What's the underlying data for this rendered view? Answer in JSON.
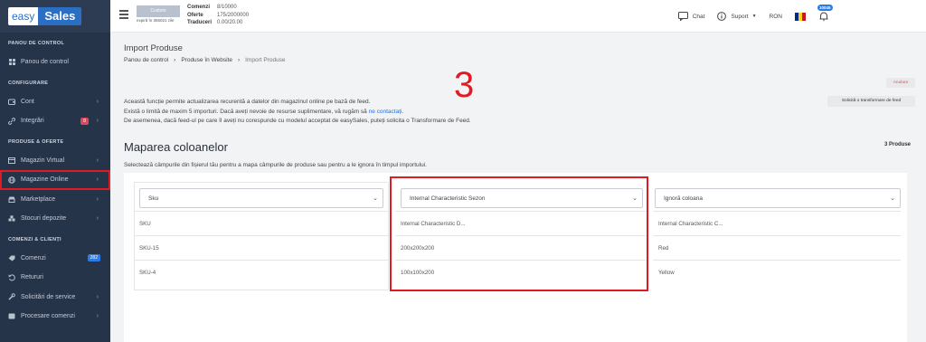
{
  "brand": {
    "easy": "easy",
    "sales": "Sales"
  },
  "sidebar": {
    "sections": [
      {
        "title": "PANOU DE CONTROL",
        "items": [
          {
            "label": "Panou de control",
            "icon": "dashboard-icon"
          }
        ]
      },
      {
        "title": "CONFIGURARE",
        "items": [
          {
            "label": "Cont",
            "icon": "wallet-icon",
            "chevron": true
          },
          {
            "label": "Integrări",
            "icon": "link-icon",
            "chevron": true,
            "badge": "8",
            "badge_color": "#e0455a"
          }
        ]
      },
      {
        "title": "PRODUSE & OFERTE",
        "items": [
          {
            "label": "Magazin Virtual",
            "icon": "store-icon",
            "chevron": true
          },
          {
            "label": "Magazine Online",
            "icon": "globe-icon",
            "chevron": true,
            "highlighted": true
          },
          {
            "label": "Marketplace",
            "icon": "marketplace-icon",
            "chevron": true
          },
          {
            "label": "Stocuri depozite",
            "icon": "warehouse-icon",
            "chevron": true
          }
        ]
      },
      {
        "title": "COMENZI & CLIENȚI",
        "items": [
          {
            "label": "Comenzi",
            "icon": "orders-icon",
            "badge": "282",
            "badge_color": "#2d7be5"
          },
          {
            "label": "Retururi",
            "icon": "returns-icon"
          },
          {
            "label": "Solicitări de service",
            "icon": "wrench-icon",
            "chevron": true
          },
          {
            "label": "Procesare comenzi",
            "icon": "process-icon",
            "chevron": true
          }
        ]
      }
    ]
  },
  "topbar": {
    "plan": {
      "name": "Custom",
      "expires": "expiră în 356021 zile"
    },
    "quotas": [
      {
        "label": "Comenzi",
        "value": "8/10000"
      },
      {
        "label": "Oferte",
        "value": "175/2000000"
      },
      {
        "label": "Traduceri",
        "value": "0.00/20.00"
      }
    ],
    "chat": "Chat",
    "support": "Suport",
    "currency": "RON",
    "notifications": "10045",
    "flag_colors": [
      "#002b7f",
      "#fcd116",
      "#ce1126"
    ]
  },
  "main": {
    "title": "Import Produse",
    "breadcrumb": [
      "Panou de control",
      "Produse în Website",
      "Import Produse"
    ],
    "annotation_number": "3",
    "cancel_button": "Anulare",
    "transform_button": "Solicită o transformare de feed",
    "info": {
      "line1": "Această funcție permite actualizarea recurentă a datelor din magazinul online pe bază de feed.",
      "line2_pre": "Există o limită de maxim 5 importuri. Dacă aveți nevoie de resurse suplimentare, vă rugăm să ",
      "line2_link": "ne contactați",
      "line2_post": ".",
      "line3": "De asemenea, dacă feed-ul pe care îl aveți nu corespunde cu modelul acceptat de easySales, puteți solicita o Transformare de Feed."
    },
    "mapping_title": "Maparea coloanelor",
    "products_count": "3 Produse",
    "mapping_desc": "Selectează câmpurile din fișierul tău pentru a mapa câmpurile de produse sau pentru a le ignora în timpul importului.",
    "columns": [
      {
        "select": "Sku",
        "cells": [
          "SKU",
          "SKU-15",
          "SKU-4"
        ]
      },
      {
        "select": "Internal Characteristic Sezon",
        "cells": [
          "Internal Characteristic D...",
          "200x200x200",
          "100x100x200"
        ]
      },
      {
        "select": "Ignoră coloana",
        "cells": [
          "Internal Characteristic C...",
          "Red",
          "Yellow"
        ]
      }
    ],
    "highlight_color": "#e01b24"
  }
}
